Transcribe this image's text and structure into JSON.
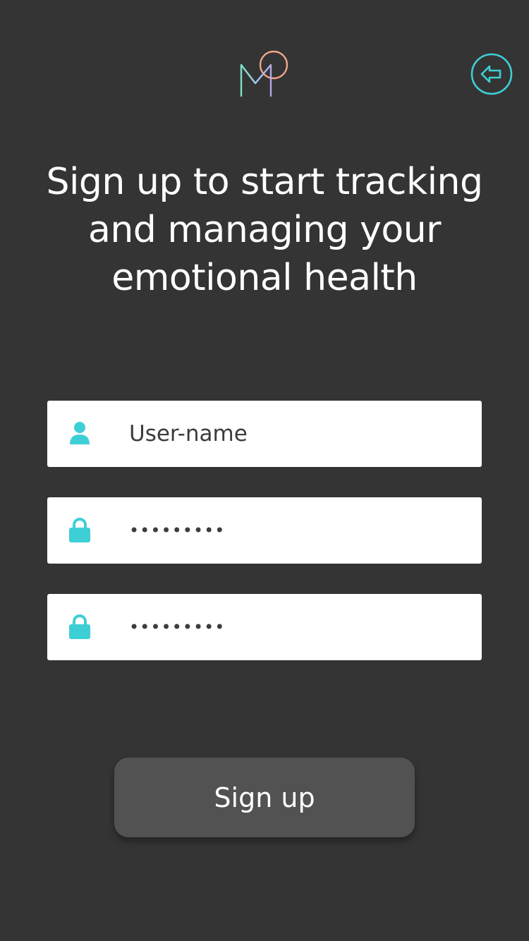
{
  "header": {
    "logo_icon": "mood-logo-icon",
    "back_icon": "back-arrow-icon"
  },
  "headline": "Sign up to start tracking and managing your emotional health",
  "form": {
    "username": {
      "icon": "user-icon",
      "placeholder": "User-name",
      "value": ""
    },
    "password": {
      "icon": "lock-icon",
      "value": "•••••••••"
    },
    "confirm_password": {
      "icon": "lock-icon",
      "value": "•••••••••"
    }
  },
  "signup_button_label": "Sign up",
  "colors": {
    "background": "#343434",
    "accent": "#3ecfd6",
    "field_bg": "#ffffff",
    "button_bg": "#525252"
  }
}
